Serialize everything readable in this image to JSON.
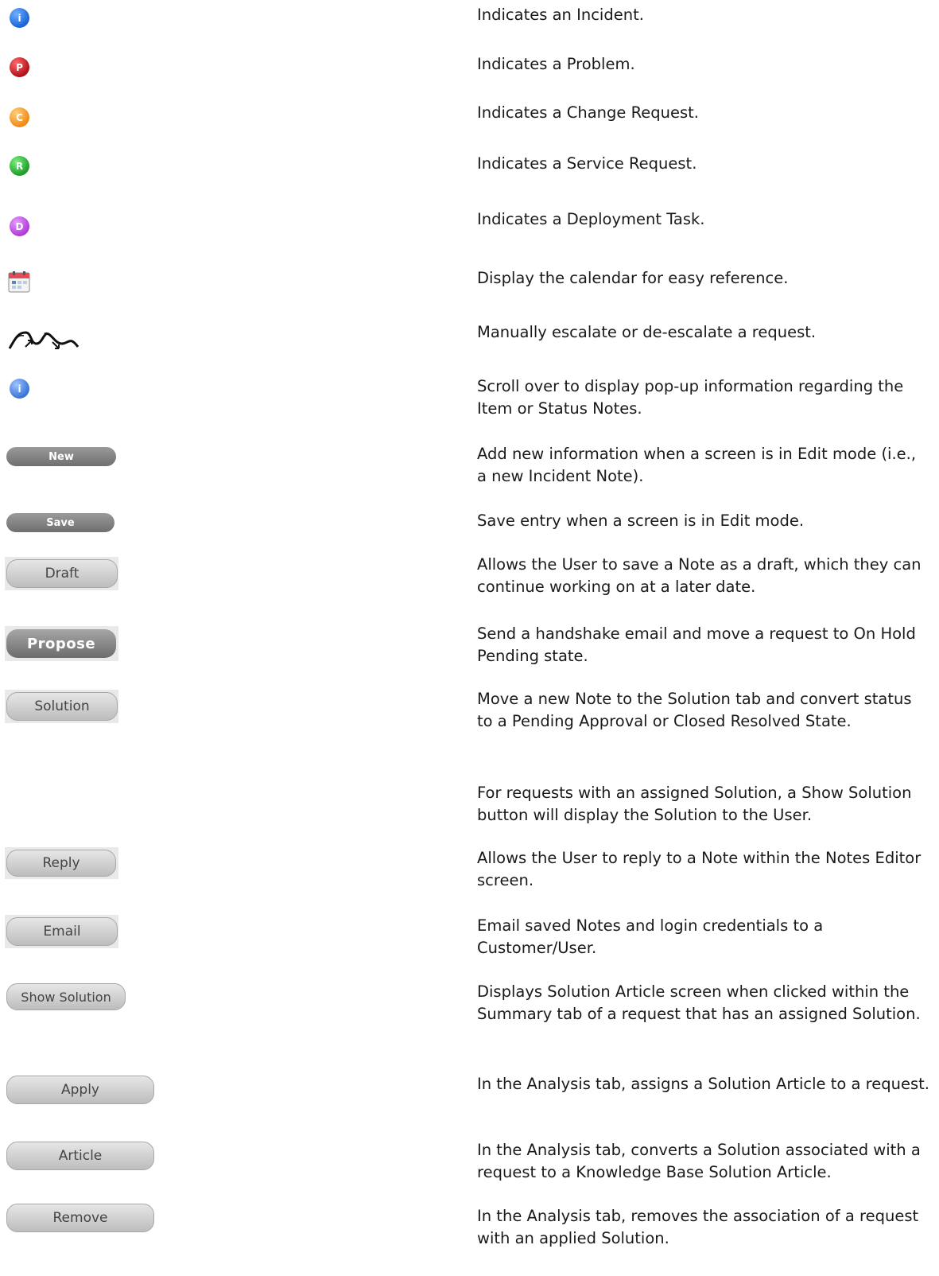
{
  "rows": [
    {
      "desc": "Indicates an Incident.",
      "icon": "incident-icon",
      "glyph": "i",
      "color": "#1a64d6"
    },
    {
      "desc": "Indicates a Problem.",
      "icon": "problem-icon",
      "glyph": "P",
      "color": "#b0121a"
    },
    {
      "desc": "Indicates a Change Request.",
      "icon": "change-request-icon",
      "glyph": "C",
      "color": "#f08a1a"
    },
    {
      "desc": "Indicates a Service Request.",
      "icon": "service-request-icon",
      "glyph": "R",
      "color": "#1f9e2a"
    },
    {
      "desc": "Indicates a Deployment Task.",
      "icon": "deployment-task-icon",
      "glyph": "D",
      "color": "#b23ad9"
    },
    {
      "desc": "Display the calendar for easy reference.",
      "icon": "calendar-icon"
    },
    {
      "desc": "Manually escalate or de-escalate a request.",
      "icon": "escalate-icon"
    },
    {
      "desc": "Scroll over to display pop-up information regarding the Item or Status Notes.",
      "icon": "info-icon",
      "glyph": "i",
      "color": "#3a74d6"
    },
    {
      "desc": "Add new information when a screen is in Edit mode (i.e., a new Incident Note).",
      "button": "New"
    },
    {
      "desc": "Save entry when a screen is in Edit mode.",
      "button": "Save"
    },
    {
      "desc": "Allows the User to save a Note as a draft, which they can continue working on at a later date.",
      "button": "Draft"
    },
    {
      "desc": "Send a handshake email and move a request to On Hold Pending state.",
      "button": "Propose"
    },
    {
      "desc": "Move a new Note to the Solution tab and convert status to a Pending Approval or Closed Resolved State.",
      "button": "Solution"
    },
    {
      "desc": "For requests with an assigned Solution, a Show Solution button will display the Solution to the User."
    },
    {
      "desc": "Allows the User to reply to a Note within the Notes Editor screen.",
      "button": "Reply"
    },
    {
      "desc": "Email saved Notes and login credentials to a Customer/User.",
      "button": "Email"
    },
    {
      "desc": "Displays Solution Article screen when clicked within the Summary tab of a request that has an assigned Solution.",
      "button": "Show Solution"
    },
    {
      "desc": "In the Analysis tab, assigns a Solution Article to a request.",
      "button": "Apply"
    },
    {
      "desc": "In the Analysis tab, converts a Solution associated with a request to a Knowledge Base Solution Article.",
      "button": "Article"
    },
    {
      "desc": "In the Analysis tab, removes the association of a request with an applied Solution.",
      "button": "Remove"
    }
  ]
}
